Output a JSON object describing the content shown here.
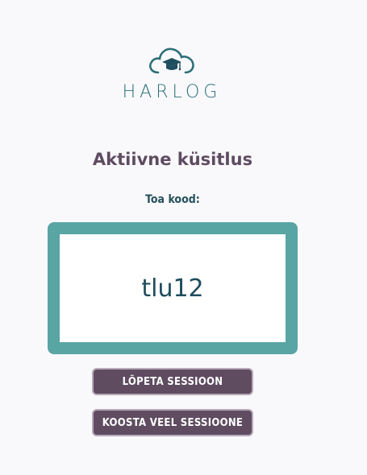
{
  "logo": {
    "text": "HARLOG",
    "icon": "cloud-graduation-cap-icon",
    "color": "#2c6f78"
  },
  "title": "Aktiivne küsitlus",
  "room_code": {
    "label": "Toa kood:",
    "value": "tlu12"
  },
  "buttons": {
    "end_session": "LÕPETA SESSIOON",
    "new_session": "KOOSTA VEEL SESSIOONE"
  },
  "colors": {
    "accent_teal": "#59a5a4",
    "button_purple": "#5f4c61",
    "title_purple": "#5f4c61",
    "code_text": "#1e4c5c"
  }
}
